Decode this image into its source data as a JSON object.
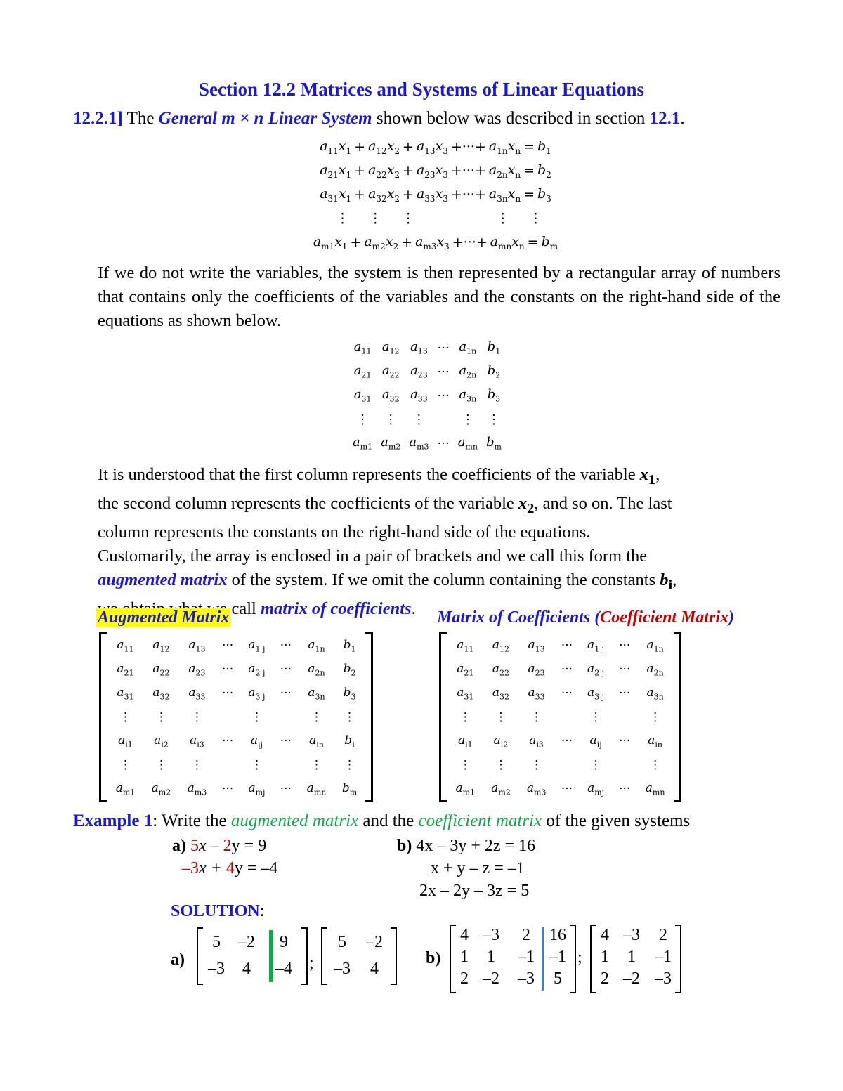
{
  "title": "Section 12.2 Matrices and Systems of Linear Equations",
  "intro": {
    "number": "12.2.1]",
    "text1": " The ",
    "term": "General m × n Linear System",
    "text2": " shown below was described in section ",
    "ref": "12.1",
    "end": "."
  },
  "general_system": [
    [
      "a",
      "11",
      "x",
      "1",
      "a",
      "12",
      "x",
      "2",
      "a",
      "13",
      "x",
      "3",
      "a",
      "1n",
      "x",
      "n",
      "b",
      "1"
    ],
    [
      "a",
      "21",
      "x",
      "1",
      "a",
      "22",
      "x",
      "2",
      "a",
      "23",
      "x",
      "3",
      "a",
      "2n",
      "x",
      "n",
      "b",
      "2"
    ],
    [
      "a",
      "31",
      "x",
      "1",
      "a",
      "32",
      "x",
      "2",
      "a",
      "33",
      "x",
      "3",
      "a",
      "3n",
      "x",
      "n",
      "b",
      "3"
    ],
    [
      "a",
      "m1",
      "x",
      "1",
      "a",
      "m2",
      "x",
      "2",
      "a",
      "m3",
      "x",
      "3",
      "a",
      "mn",
      "x",
      "n",
      "b",
      "m"
    ]
  ],
  "paragraph1": "If we do not write the variables, the system is then represented by a rectangular array of numbers that contains only the coefficients of the variables and the constants on the right-hand side of the equations as shown below.",
  "array_rows": [
    [
      "11",
      "12",
      "13",
      "1n",
      "1"
    ],
    [
      "21",
      "22",
      "23",
      "2n",
      "2"
    ],
    [
      "31",
      "32",
      "33",
      "3n",
      "3"
    ],
    [
      "m1",
      "m2",
      "m3",
      "mn",
      "m"
    ]
  ],
  "paragraph2": {
    "line1a": "It is understood that the first column represents the coefficients of the variable ",
    "line1var": "x",
    "line1sub": "1",
    "line1b": ",",
    "line2a": "the second column represents the coefficients of the variable ",
    "line2var": "x",
    "line2sub": "2",
    "line2b": ", and so on. The last",
    "line3": "column represents the constants on the right-hand side of the equations.",
    "line4": "Customarily, the array is enclosed in a pair of brackets and we call this form the",
    "line5term": "augmented matrix",
    "line5a": " of the system. If we omit the column containing the constants ",
    "line5var": "b",
    "line5sub": "i",
    "line5b": ",",
    "line6a": "we obtain what we call ",
    "line6term": "matrix of coefficients",
    "line6b": "."
  },
  "augmented_label": "Augmented Matrix",
  "coefficient_label": {
    "main": "Matrix of Coefficients ",
    "paren_open": "(",
    "alt": "Coefficient Matrix",
    "paren_close": ")"
  },
  "general_matrix_rows": [
    [
      "11",
      "12",
      "13",
      "1 j",
      "1n",
      "1"
    ],
    [
      "21",
      "22",
      "23",
      "2 j",
      "2n",
      "2"
    ],
    [
      "31",
      "32",
      "33",
      "3 j",
      "3n",
      "3"
    ],
    [
      "i1",
      "i2",
      "i3",
      "ij",
      "in",
      "i"
    ],
    [
      "m1",
      "m2",
      "m3",
      "mj",
      "mn",
      "m"
    ]
  ],
  "example": {
    "label": "Example 1",
    "colon": ": Write the ",
    "term1": "augmented matrix",
    "mid": " and the ",
    "term2": "coefficient matrix",
    "end": " of the given systems",
    "a_label": "a) ",
    "a_eq1": {
      "c1": "5",
      "v1": "x – ",
      "c2": "2",
      "v2": "y = 9"
    },
    "a_eq2": {
      "c1": "–3",
      "v1": "x + ",
      "c2": "4",
      "v2": "y = –4"
    },
    "b_label": "b) ",
    "b_eqs": [
      "4x – 3y + 2z = 16",
      "x + y – z = –1",
      "2x – 2y – 3z = 5"
    ]
  },
  "solution": {
    "label": "SOLUTION",
    "colon": ":",
    "a_label": "a)",
    "b_label": "b)",
    "separator": ";",
    "a_augmented": [
      [
        "5",
        "–2",
        "9"
      ],
      [
        "–3",
        "4",
        "–4"
      ]
    ],
    "a_coefficient": [
      [
        "5",
        "–2"
      ],
      [
        "–3",
        "4"
      ]
    ],
    "b_augmented": [
      [
        "4",
        "–3",
        "2",
        "16"
      ],
      [
        "1",
        "1",
        "–1",
        "–1"
      ],
      [
        "2",
        "–2",
        "–3",
        "5"
      ]
    ],
    "b_coefficient": [
      [
        "4",
        "–3",
        "2"
      ],
      [
        "1",
        "1",
        "–1"
      ],
      [
        "2",
        "–2",
        "–3"
      ]
    ]
  },
  "colors": {
    "heading_blue": "#1a1acc",
    "highlight_yellow": "#ffff00",
    "accent_red": "#c00000",
    "accent_green": "#12a84a",
    "divider_blue": "#3a7fd0"
  }
}
